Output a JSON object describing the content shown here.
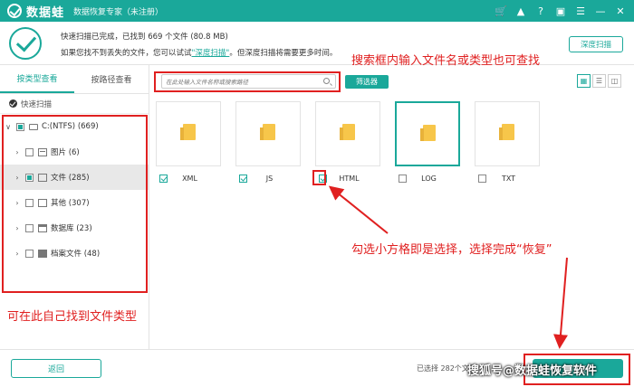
{
  "titlebar": {
    "app_name": "数据蛙",
    "subtitle": "数据恢复专家（未注册）",
    "icons": [
      "cart-icon",
      "bell-icon",
      "help-icon",
      "save-icon",
      "menu-icon",
      "minimize-icon",
      "close-icon"
    ]
  },
  "status": {
    "line1": "快速扫描已完成，已找到  669 个文件 (80.8 MB)",
    "line2_prefix": "如果您找不到丢失的文件，您可以试试",
    "line2_link": "\"深度扫描\"",
    "line2_suffix": "。但深度扫描将需要更多时间。",
    "deep_scan_button": "深度扫描"
  },
  "sidebar": {
    "tabs": [
      "按类型查看",
      "按路径查看"
    ],
    "quick_scan": "快速扫描",
    "tree": [
      {
        "label": "C:(NTFS) (669)",
        "state": "partial"
      },
      {
        "label": "图片 (6)",
        "state": "empty"
      },
      {
        "label": "文件 (285)",
        "state": "partial"
      },
      {
        "label": "其他 (307)",
        "state": "empty"
      },
      {
        "label": "数据库 (23)",
        "state": "empty"
      },
      {
        "label": "档案文件 (48)",
        "state": "empty"
      }
    ]
  },
  "content": {
    "search_placeholder": "在此处输入文件名称或搜索路径",
    "filter_button": "筛选器",
    "tiles": [
      {
        "label": "XML",
        "checked": true
      },
      {
        "label": "JS",
        "checked": true
      },
      {
        "label": "HTML",
        "checked": true
      },
      {
        "label": "LOG",
        "checked": false
      },
      {
        "label": "TXT",
        "checked": false
      }
    ]
  },
  "bottom": {
    "back_button": "返回",
    "selected_info": "已选择 282个文件",
    "recover_button": "恢复"
  },
  "annotations": {
    "search_hint": "搜索框内输入文件名或类型也可查找",
    "select_hint": "勾选小方格即是选择，选择完成“恢复”",
    "sidebar_hint": "可在此自己找到文件类型"
  },
  "watermark": "搜狐号@数据蛙恢复软件",
  "colors": {
    "accent": "#1aa89a",
    "annotation": "#e02020",
    "folder": "#f7c64a"
  }
}
